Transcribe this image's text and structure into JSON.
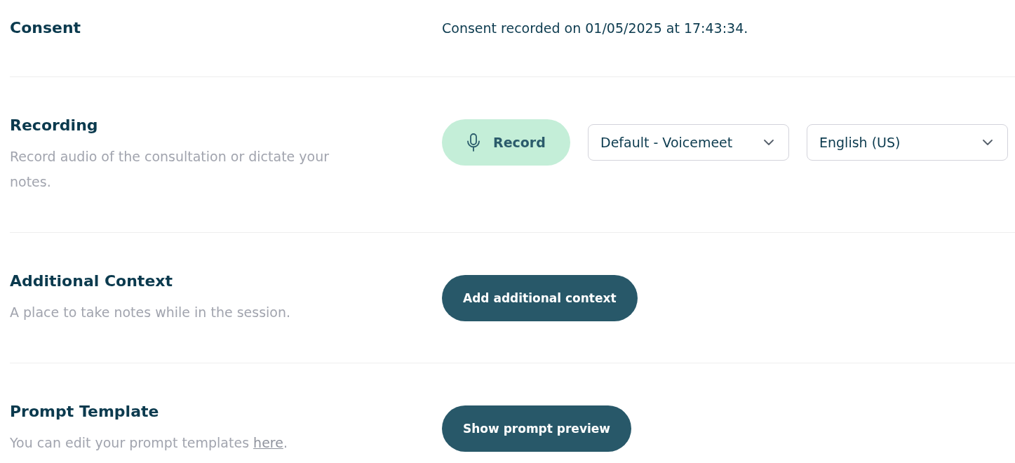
{
  "sections": [
    {
      "kind": "consent",
      "title": "Consent",
      "text": "Consent recorded on 01/05/2025 at 17:43:34."
    },
    {
      "kind": "recorder",
      "title": "Recording",
      "description": "Record audio of the consultation or dictate your notes.",
      "record_button": "Record",
      "dropdowns": [
        "Default - Voicemeet",
        "English (US)"
      ]
    },
    {
      "kind": "action",
      "title": "Additional Context",
      "description": "A place to take notes while in the session.",
      "button": "Add additional context"
    },
    {
      "kind": "action",
      "title": "Prompt Template",
      "description": "You can edit your prompt templates ",
      "link": "here",
      "after_link": ".",
      "button": "Show prompt preview"
    }
  ]
}
